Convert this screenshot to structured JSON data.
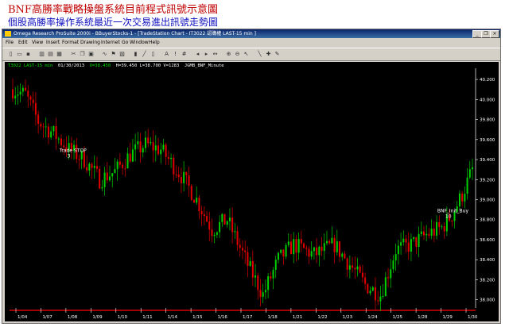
{
  "heading": {
    "title": "BNF高勝率戰略操盤系統目前程式訊號示意圖",
    "subtitle": "個股高勝率操作系統最近一次交易進出訊號走勢圖"
  },
  "window": {
    "title": "Omega Research ProSuite 2000i - BBuyerStocks-1 - [TradeStation Chart - IT3022 認購權 LAST-15 min ]",
    "minimize_glyph": "_",
    "restore_glyph": "❐",
    "close_glyph": "×"
  },
  "menu": [
    "File",
    "Edit",
    "View",
    "Insert",
    "Format",
    "Drawing",
    "Internet",
    "Go",
    "Window",
    "Help"
  ],
  "chart_info": {
    "symbol": "T3022 LAST-15 min",
    "date": "01/30/2013",
    "open": "O=38.450",
    "high": "H=39.450",
    "low": "L=38.700",
    "volume": "V=1283",
    "study": "JGMB_BNF_Minute"
  },
  "colors": {
    "up": "#00d000",
    "down": "#e00000",
    "background": "#000000",
    "axis": "#ff0000"
  },
  "chart_data": {
    "type": "candlestick",
    "y_ticks": [
      "40.200",
      "40.000",
      "39.800",
      "39.600",
      "39.400",
      "39.200",
      "39.000",
      "38.800",
      "38.600",
      "38.400",
      "38.200",
      "38.000"
    ],
    "x_ticks": [
      "1/04",
      "1/07",
      "1/08",
      "1/09",
      "1/10",
      "1/11",
      "1/14",
      "1/15",
      "1/16",
      "1/17",
      "1/18",
      "1/21",
      "1/22",
      "1/23",
      "1/24",
      "1/25",
      "1/28",
      "1/29",
      "1/30"
    ],
    "ylim": [
      37.95,
      40.28
    ],
    "signals": [
      {
        "label": "Trade STOP",
        "sub": "3",
        "bar_index": 22,
        "price": 39.38
      },
      {
        "label": "BNF_Init_Buy",
        "sub": "10",
        "bar_index": 170,
        "price": 38.78
      }
    ],
    "anchors": [
      [
        0,
        40.1
      ],
      [
        5,
        40.05
      ],
      [
        10,
        39.78
      ],
      [
        16,
        39.66
      ],
      [
        22,
        39.5
      ],
      [
        28,
        39.4
      ],
      [
        34,
        39.2
      ],
      [
        40,
        39.28
      ],
      [
        46,
        39.45
      ],
      [
        52,
        39.55
      ],
      [
        58,
        39.5
      ],
      [
        66,
        39.24
      ],
      [
        72,
        39.0
      ],
      [
        78,
        38.7
      ],
      [
        84,
        38.8
      ],
      [
        92,
        38.35
      ],
      [
        98,
        38.05
      ],
      [
        104,
        38.4
      ],
      [
        110,
        38.55
      ],
      [
        118,
        38.45
      ],
      [
        126,
        38.55
      ],
      [
        132,
        38.35
      ],
      [
        138,
        38.15
      ],
      [
        144,
        38.05
      ],
      [
        150,
        38.5
      ],
      [
        156,
        38.55
      ],
      [
        162,
        38.65
      ],
      [
        168,
        38.72
      ],
      [
        172,
        38.85
      ],
      [
        176,
        39.05
      ],
      [
        180,
        39.3
      ]
    ],
    "bar_count": 181
  }
}
